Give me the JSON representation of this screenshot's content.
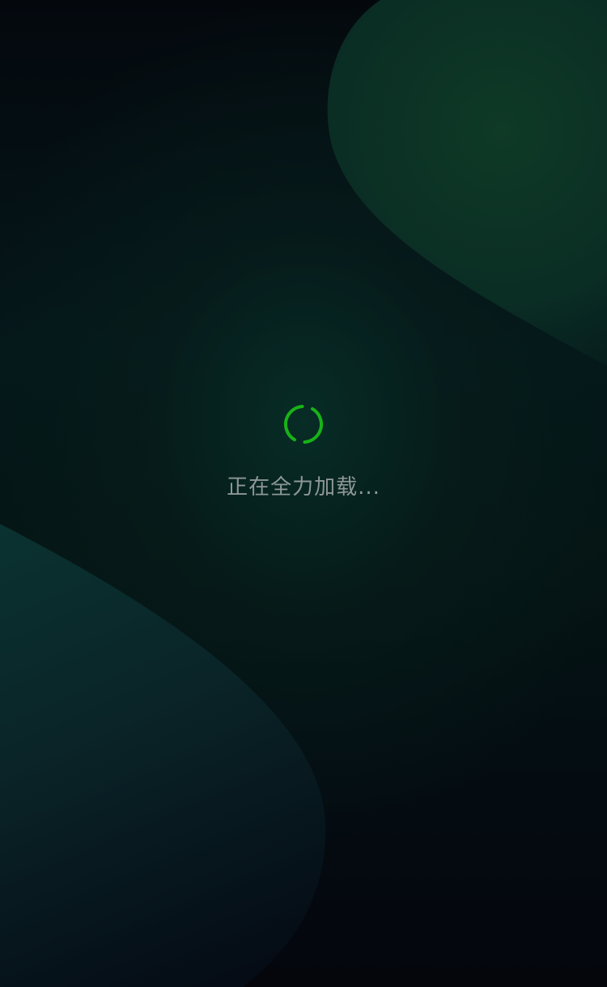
{
  "loading": {
    "message": "正在全力加载...",
    "spinner_icon": "loading-spinner-icon"
  },
  "colors": {
    "spinner": "#18b218",
    "text": "#8e9896",
    "background_dark": "#040910",
    "wave_green": "#0e3a2a"
  }
}
